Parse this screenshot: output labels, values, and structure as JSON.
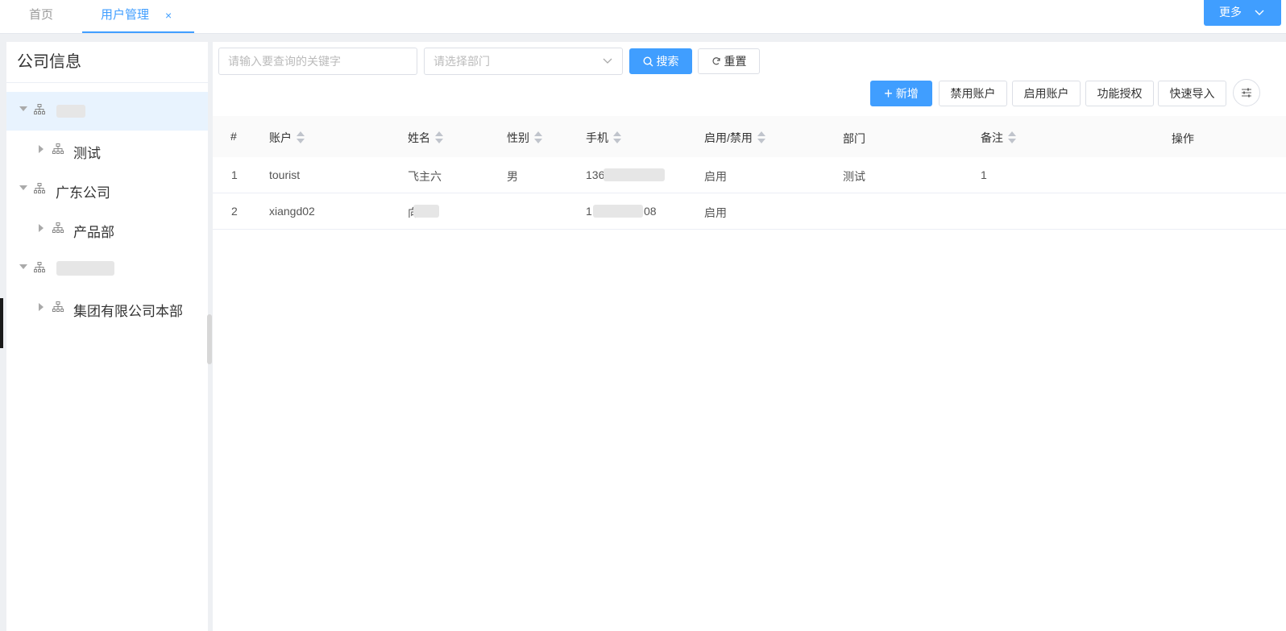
{
  "tabs": {
    "home": "首页",
    "active": "用户管理",
    "close": "×"
  },
  "more_button": {
    "label": "更多",
    "chevron": "﹀"
  },
  "sidebar": {
    "title": "公司信息",
    "nodes": [
      {
        "label": "",
        "level": 0,
        "expanded": true
      },
      {
        "label": "测试",
        "level": 1,
        "expanded": false
      },
      {
        "label": "广东公司",
        "level": 0,
        "expanded": true
      },
      {
        "label": "产品部",
        "level": 1,
        "expanded": false
      },
      {
        "label": "",
        "level": 0,
        "expanded": true
      },
      {
        "label": "集团有限公司本部",
        "level": 1,
        "expanded": false
      }
    ]
  },
  "search": {
    "keyword_placeholder": "请输入要查询的关键字",
    "dept_placeholder": "请选择部门",
    "search_label": "搜索",
    "reset_label": "重置"
  },
  "toolbar": {
    "add_label": "新增",
    "disable_label": "禁用账户",
    "enable_label": "启用账户",
    "auth_label": "功能授权",
    "import_label": "快速导入",
    "settings_icon": "sliders-icon"
  },
  "table": {
    "columns": [
      "#",
      "账户",
      "姓名",
      "性别",
      "手机",
      "启用/禁用",
      "部门",
      "备注",
      "操作"
    ],
    "rows": [
      {
        "index": "1",
        "account": "tourist",
        "name": "飞主六",
        "gender": "男",
        "phone": "136",
        "status": "启用",
        "dept": "测试",
        "remark": "1"
      },
      {
        "index": "2",
        "account": "xiangd02",
        "name": "向",
        "gender": "",
        "phone": "1",
        "phone_end": "08",
        "status": "启用",
        "dept": "",
        "remark": ""
      }
    ]
  },
  "colors": {
    "accent": "#409eff",
    "selected_bg": "#e8f3fe"
  }
}
